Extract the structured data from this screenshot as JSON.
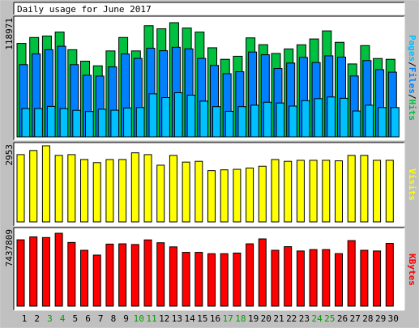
{
  "chart_data": {
    "type": "bar",
    "title": "Daily usage for June 2017",
    "days": [
      "1",
      "2",
      "3",
      "4",
      "5",
      "6",
      "7",
      "8",
      "9",
      "10",
      "11",
      "12",
      "13",
      "14",
      "15",
      "16",
      "17",
      "18",
      "19",
      "20",
      "21",
      "22",
      "23",
      "24",
      "25",
      "26",
      "27",
      "28",
      "29",
      "30"
    ],
    "weekend_days": [
      "3",
      "4",
      "10",
      "11",
      "17",
      "18",
      "24",
      "25"
    ],
    "colors": {
      "hits": "#00c040",
      "files": "#0080ff",
      "pages": "#00c0ff",
      "visits": "#ffff00",
      "kbytes": "#ff0000",
      "weekday_label": "#000000",
      "weekend_label": "#00a000"
    },
    "panels": [
      {
        "key": "usage",
        "max_label": "118971",
        "legend": [
          "Pages",
          "Files",
          "Hits"
        ],
        "ylim": [
          0,
          118971
        ],
        "series": [
          {
            "name": "Hits",
            "values": [
              94700,
              100700,
              102200,
              106200,
              88300,
              76700,
              72000,
              87100,
              100700,
              87100,
              112600,
              109500,
              115700,
              110300,
              106200,
              90300,
              78600,
              81700,
              100300,
              93400,
              84500,
              89100,
              93300,
              99200,
              107400,
              95800,
              73900,
              92500,
              79400,
              78600
            ]
          },
          {
            "name": "Files",
            "values": [
              73200,
              84000,
              88300,
              91800,
              73200,
              62400,
              61600,
              70900,
              84000,
              79500,
              89800,
              87300,
              90800,
              89200,
              79500,
              72400,
              64000,
              66000,
              86000,
              83200,
              69300,
              74800,
              80500,
              75300,
              82100,
              80800,
              61700,
              77300,
              68100,
              65600
            ]
          },
          {
            "name": "Pages",
            "values": [
              28700,
              28700,
              30900,
              28700,
              26900,
              25700,
              28000,
              27000,
              29300,
              29700,
              43600,
              39800,
              44700,
              42300,
              36200,
              30600,
              25900,
              30600,
              32100,
              35100,
              34300,
              31200,
              36700,
              38700,
              40400,
              39100,
              26200,
              32100,
              29700,
              29700
            ]
          }
        ]
      },
      {
        "key": "visits",
        "max_label": "2953",
        "legend": [
          "Visits"
        ],
        "ylim": [
          0,
          2953
        ],
        "series": [
          {
            "name": "Visits",
            "values": [
              2610,
              2770,
              2953,
              2580,
              2610,
              2420,
              2300,
              2420,
              2420,
              2680,
              2610,
              2200,
              2580,
              2320,
              2350,
              1990,
              2020,
              2040,
              2090,
              2160,
              2420,
              2350,
              2390,
              2390,
              2390,
              2370,
              2580,
              2580,
              2390,
              2390
            ]
          }
        ]
      },
      {
        "key": "kbytes",
        "max_label": "7437809",
        "legend": [
          "KBytes"
        ],
        "ylim": [
          0,
          7437809
        ],
        "series": [
          {
            "name": "KBytes",
            "values": [
              6770000,
              7070000,
              7000000,
              7437809,
              6500000,
              5700000,
              5210000,
              6330000,
              6360000,
              6290000,
              6760000,
              6470000,
              6050000,
              5490000,
              5490000,
              5350000,
              5350000,
              5420000,
              6360000,
              6860000,
              5700000,
              6070000,
              5630000,
              5770000,
              5770000,
              5360000,
              6690000,
              5700000,
              5630000,
              6400000
            ]
          }
        ]
      }
    ]
  }
}
